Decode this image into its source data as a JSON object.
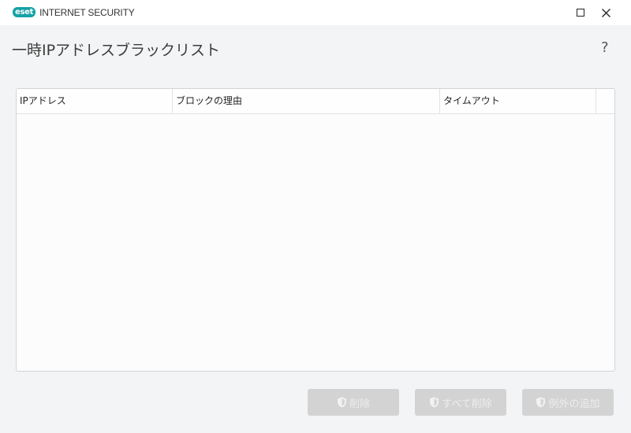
{
  "app": {
    "logo_text": "eset",
    "name": "INTERNET SECURITY"
  },
  "window_controls": {
    "maximize_icon": "maximize-icon",
    "close_icon": "close-icon"
  },
  "page": {
    "title": "一時IPアドレスブラックリスト",
    "help_label": "?"
  },
  "table": {
    "columns": [
      "IPアドレス",
      "ブロックの理由",
      "タイムアウト",
      ""
    ],
    "rows": []
  },
  "buttons": {
    "delete_label": "削除",
    "delete_all_label": "すべて削除",
    "add_exception_label": "例外の追加",
    "state": "disabled",
    "icon": "shield-icon"
  },
  "colors": {
    "brand": "#16a1a6",
    "button_disabled": "#d3d3d3",
    "button_text_disabled": "#ededed"
  }
}
